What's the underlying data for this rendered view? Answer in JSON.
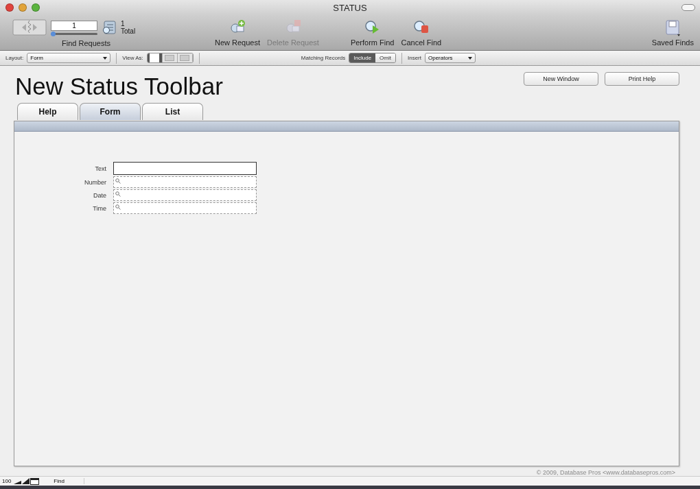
{
  "window": {
    "title": "STATUS"
  },
  "toolbar": {
    "record_nav": {
      "current": "1",
      "total_count": "1",
      "total_label": "Total",
      "group_label": "Find Requests",
      "level": 0
    },
    "actions": [
      {
        "kind": "new",
        "label": "New Request",
        "disabled": false
      },
      {
        "kind": "delete",
        "label": "Delete Request",
        "disabled": true
      },
      {
        "kind": "perform",
        "label": "Perform Find",
        "disabled": false
      },
      {
        "kind": "cancel",
        "label": "Cancel Find",
        "disabled": false
      }
    ],
    "saved_finds": {
      "label": "Saved Finds"
    }
  },
  "layout_bar": {
    "layout_label": "Layout:",
    "layout_value": "Form",
    "view_as_label": "View As:",
    "view_buttons": [
      {
        "kind": "form",
        "selected": true
      },
      {
        "kind": "list",
        "selected": false
      },
      {
        "kind": "table",
        "selected": false
      }
    ],
    "matching_label": "Matching Records",
    "matching_options": [
      {
        "label": "Include",
        "selected": true
      },
      {
        "label": "Omit",
        "selected": false
      }
    ],
    "insert_label": "Insert",
    "insert_value": "Operators"
  },
  "page": {
    "heading": "New Status Toolbar",
    "buttons": [
      "New Window",
      "Print Help"
    ],
    "tabs": [
      {
        "label": "Help",
        "selected": false
      },
      {
        "label": "Form",
        "selected": true
      },
      {
        "label": "List",
        "selected": false
      }
    ],
    "fields": [
      {
        "label": "Text",
        "kind": "plain",
        "active": true
      },
      {
        "label": "Number",
        "kind": "find",
        "active": false
      },
      {
        "label": "Date",
        "kind": "find",
        "active": false
      },
      {
        "label": "Time",
        "kind": "find",
        "active": false
      }
    ],
    "copyright": "© 2009, Database Pros <www.databasepros.com>"
  },
  "status_bar": {
    "zoom": "100",
    "mode": "Find"
  }
}
